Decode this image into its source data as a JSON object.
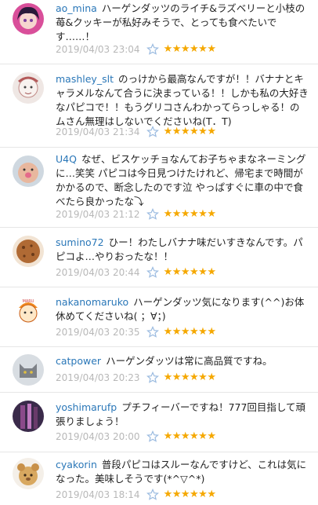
{
  "comments": [
    {
      "user": "ao_mina",
      "text": "ハーゲンダッツのライチ&ラズベリーと小枝の苺&クッキーが私好みそうで、とっても食べたいです……！",
      "time": "2019/04/03 23:04",
      "stars": "★★★★★★"
    },
    {
      "user": "mashley_slt",
      "text": "のっけから最高なんですが！！バナナとキャラメルなんて合うに決まっている！！しかも私の大好きなパピコで！！もうグリコさんわかってらっしゃる！のムさん無理はしないでくださいね(T．T)",
      "time": "2019/04/03 21:34",
      "stars": "★★★★★★"
    },
    {
      "user": "U4Q",
      "text": "なぜ、ビスケッチョなんてお子ちゃまなネーミングに…笑笑 パピコは今日見つけたけれど、帰宅まで時間がかかるので、断念したのです泣 やっぱすぐに車の中で食べたら良かったな⤵︎",
      "time": "2019/04/03 21:12",
      "stars": "★★★★★★"
    },
    {
      "user": "sumino72",
      "text": "ひー！わたしバナナ味だいすきなんです。パピコよ…やりおったな！！",
      "time": "2019/04/03 20:44",
      "stars": "★★★★★★"
    },
    {
      "user": "nakanomaruko",
      "text": "ハーゲンダッツ気になります(^^)お体休めてくださいね( ；∀；)",
      "time": "2019/04/03 20:35",
      "stars": "★★★★★★"
    },
    {
      "user": "catpower",
      "text": "ハーゲンダッツは常に高品質ですね。",
      "time": "2019/04/03 20:23",
      "stars": "★★★★★★"
    },
    {
      "user": "yoshimarufp",
      "text": "プチフィーバーですね！777回目指して頑張りましょう！",
      "time": "2019/04/03 20:00",
      "stars": "★★★★★★"
    },
    {
      "user": "cyakorin",
      "text": "普段パピコはスルーなんですけど、これは気になった。美味しそうです(*^▽^*)",
      "time": "2019/04/03 18:14",
      "stars": "★★★★★★"
    }
  ],
  "colors": {
    "username": "#2a77b8",
    "star": "#f5a800",
    "meta": "#b8b8b8"
  }
}
